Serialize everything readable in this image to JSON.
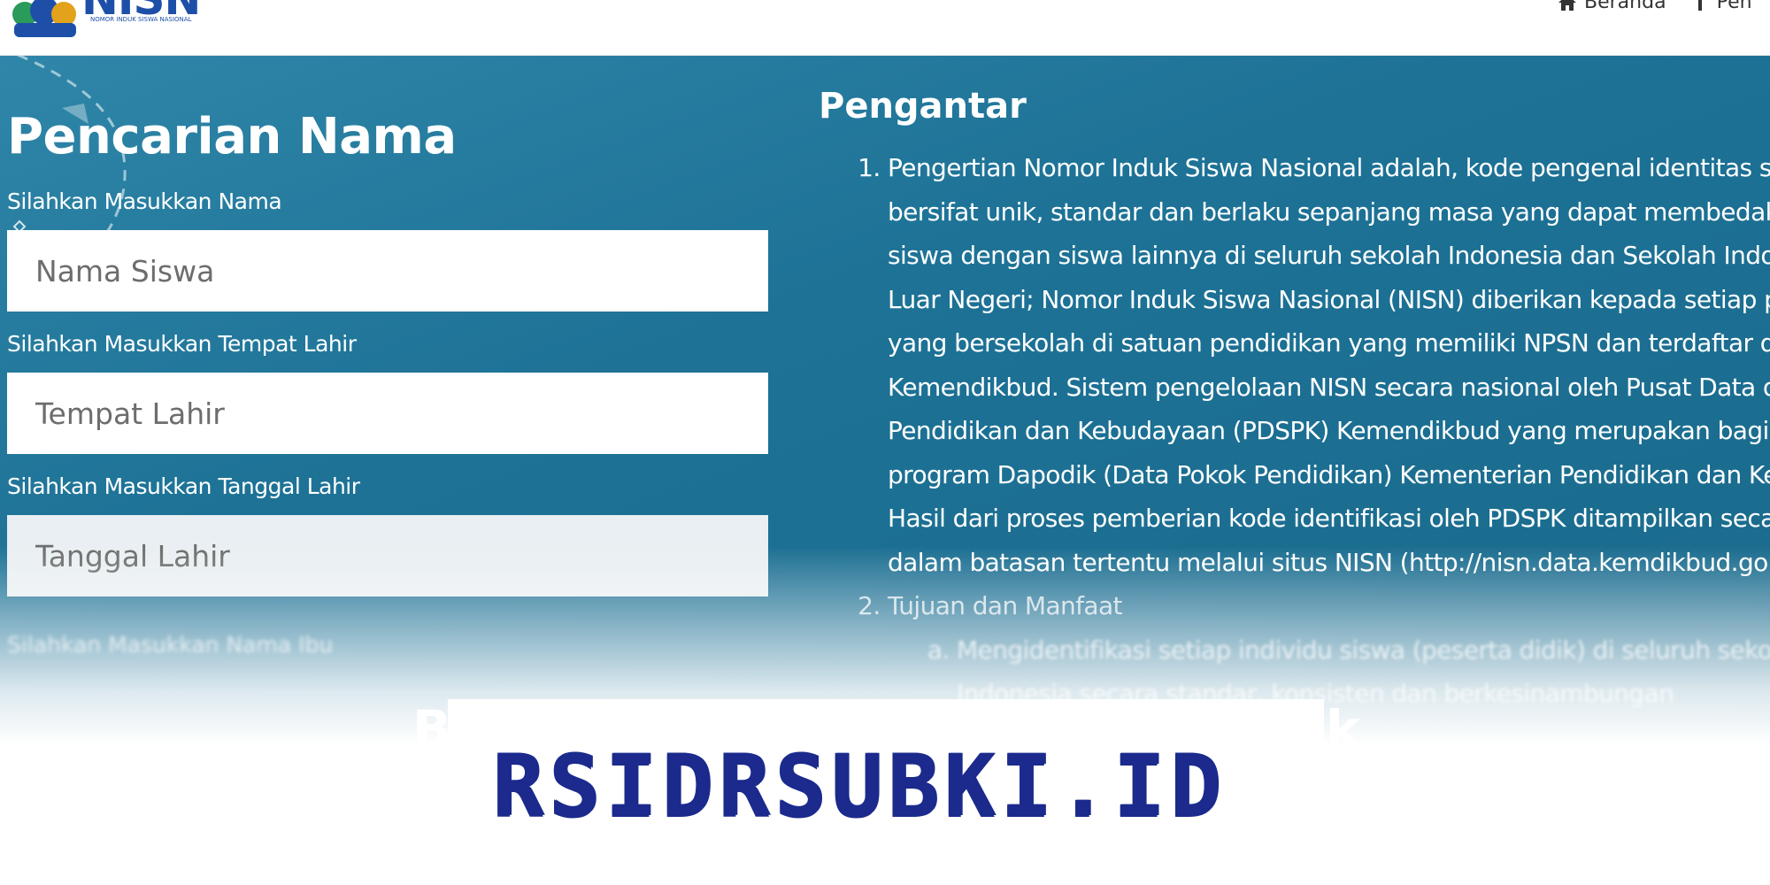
{
  "header": {
    "logo_text": "NISN",
    "logo_subtitle": "NOMOR INDUK SISWA NASIONAL",
    "nav": [
      {
        "label": "Beranda",
        "icon": "home-icon"
      },
      {
        "label": "Pen",
        "icon": "info-icon"
      }
    ]
  },
  "search": {
    "title": "Pencarian Nama",
    "fields": [
      {
        "label": "Silahkan Masukkan Nama",
        "placeholder": "Nama Siswa"
      },
      {
        "label": "Silahkan Masukkan Tempat Lahir",
        "placeholder": "Tempat Lahir"
      },
      {
        "label": "Silahkan Masukkan Tanggal Lahir",
        "placeholder": "Tanggal Lahir"
      }
    ],
    "next_label": "Silahkan Masukkan Nama Ibu"
  },
  "intro": {
    "title": "Pengantar",
    "item1_lines": [
      "Pengertian Nomor Induk Siswa Nasional adalah, kode pengenal identitas sis",
      "bersifat unik, standar dan berlaku sepanjang masa yang dapat membedakan",
      "siswa dengan siswa lainnya di seluruh sekolah Indonesia dan Sekolah Indon",
      "Luar Negeri; Nomor Induk Siswa Nasional (NISN) diberikan kepada setiap pe",
      "yang bersekolah di satuan pendidikan yang memiliki NPSN dan terdaftar di",
      "Kemendikbud. Sistem pengelolaan NISN secara nasional oleh Pusat Data da",
      "Pendidikan dan Kebudayaan (PDSPK) Kemendikbud yang merupakan bagia",
      "program Dapodik (Data Pokok Pendidikan) Kementerian Pendidikan dan Ke",
      "Hasil dari proses pemberian kode identifikasi oleh PDSPK ditampilkan secar",
      "dalam batasan tertentu melalui situs NISN (http://nisn.data.kemdikbud.go.i"
    ],
    "item2_title": "Tujuan dan Manfaat",
    "item2_sub_lines": [
      "Mengidentifikasi setiap individu siswa (peserta didik) di seluruh sekola",
      "Indonesia secara standar, konsisten dan berkesinambungan"
    ]
  },
  "watermark": {
    "text": "RSIDRSUBKI.ID",
    "peek_left": "B",
    "peek_right": "k"
  }
}
